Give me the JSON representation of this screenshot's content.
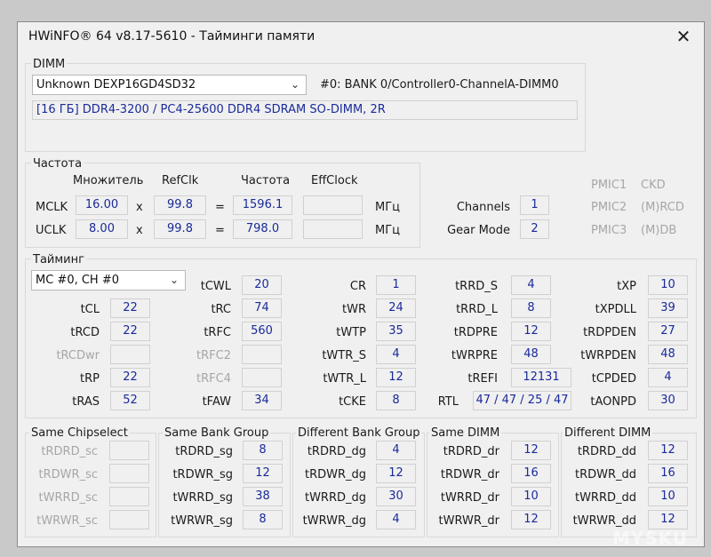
{
  "window": {
    "title": "HWiNFO® 64 v8.17-5610 - Тайминги памяти",
    "close_glyph": "✕"
  },
  "dimm": {
    "legend": "DIMM",
    "selected_module": "Unknown DEXP16GD4SD32",
    "slot_info": "#0: BANK 0/Controller0-ChannelA-DIMM0",
    "module_desc": "[16 ГБ] DDR4-3200 / PC4-25600 DDR4 SDRAM SO-DIMM, 2R"
  },
  "freq": {
    "legend": "Частота",
    "hdr_mult": "Множитель",
    "hdr_refclk": "RefClk",
    "hdr_freq": "Частота",
    "hdr_effclock": "EffClock",
    "mclk_label": "MCLK",
    "mclk_mult": "16.00",
    "mclk_refclk": "99.8",
    "mclk_freq": "1596.1",
    "mclk_eff": "",
    "uclk_label": "UCLK",
    "uclk_mult": "8.00",
    "uclk_refclk": "99.8",
    "uclk_freq": "798.0",
    "uclk_eff": "",
    "x_sign": "x",
    "eq_sign": "=",
    "unit": "МГц",
    "channels_label": "Channels",
    "channels_value": "1",
    "gearmode_label": "Gear Mode",
    "gearmode_value": "2",
    "pmic1": "PMIC1",
    "pmic1_val": "CKD",
    "pmic2": "PMIC2",
    "pmic2_val": "(M)RCD",
    "pmic3": "PMIC3",
    "pmic3_val": "(M)DB"
  },
  "timing": {
    "legend": "Тайминг",
    "controller": "MC #0, CH #0",
    "tCL": "22",
    "tRCD": "22",
    "tRCDwr": "",
    "tRP": "22",
    "tRAS": "52",
    "tCWL": "20",
    "tRC": "74",
    "tRFC": "560",
    "tRFC2": "",
    "tRFC4": "",
    "tFAW": "34",
    "CR": "1",
    "tWR": "24",
    "tWTP": "35",
    "tWTR_S": "4",
    "tWTR_L": "12",
    "tCKE": "8",
    "tRRD_S": "4",
    "tRRD_L": "8",
    "tRDPRE": "12",
    "tWRPRE": "48",
    "tREFI": "12131",
    "RTL": "47 / 47 / 25 / 47",
    "tXP": "10",
    "tXPDLL": "39",
    "tRDPDEN": "27",
    "tWRPDEN": "48",
    "tCPDED": "4",
    "tAONPD": "30"
  },
  "groups": {
    "same_cs": {
      "legend": "Same Chipselect",
      "tRDRD_sc": "",
      "tRDWR_sc": "",
      "tWRRD_sc": "",
      "tWRWR_sc": ""
    },
    "same_bg": {
      "legend": "Same Bank Group",
      "tRDRD_sg": "8",
      "tRDWR_sg": "12",
      "tWRRD_sg": "38",
      "tWRWR_sg": "8"
    },
    "diff_bg": {
      "legend": "Different Bank Group",
      "tRDRD_dg": "4",
      "tRDWR_dg": "12",
      "tWRRD_dg": "30",
      "tWRWR_dg": "4"
    },
    "same_dimm": {
      "legend": "Same DIMM",
      "tRDRD_dr": "12",
      "tRDWR_dr": "16",
      "tWRRD_dr": "10",
      "tWRWR_dr": "12"
    },
    "diff_dimm": {
      "legend": "Different DIMM",
      "tRDRD_dd": "12",
      "tRDWR_dd": "16",
      "tWRRD_dd": "10",
      "tWRWR_dd": "12"
    }
  },
  "watermark": "MYSKU"
}
